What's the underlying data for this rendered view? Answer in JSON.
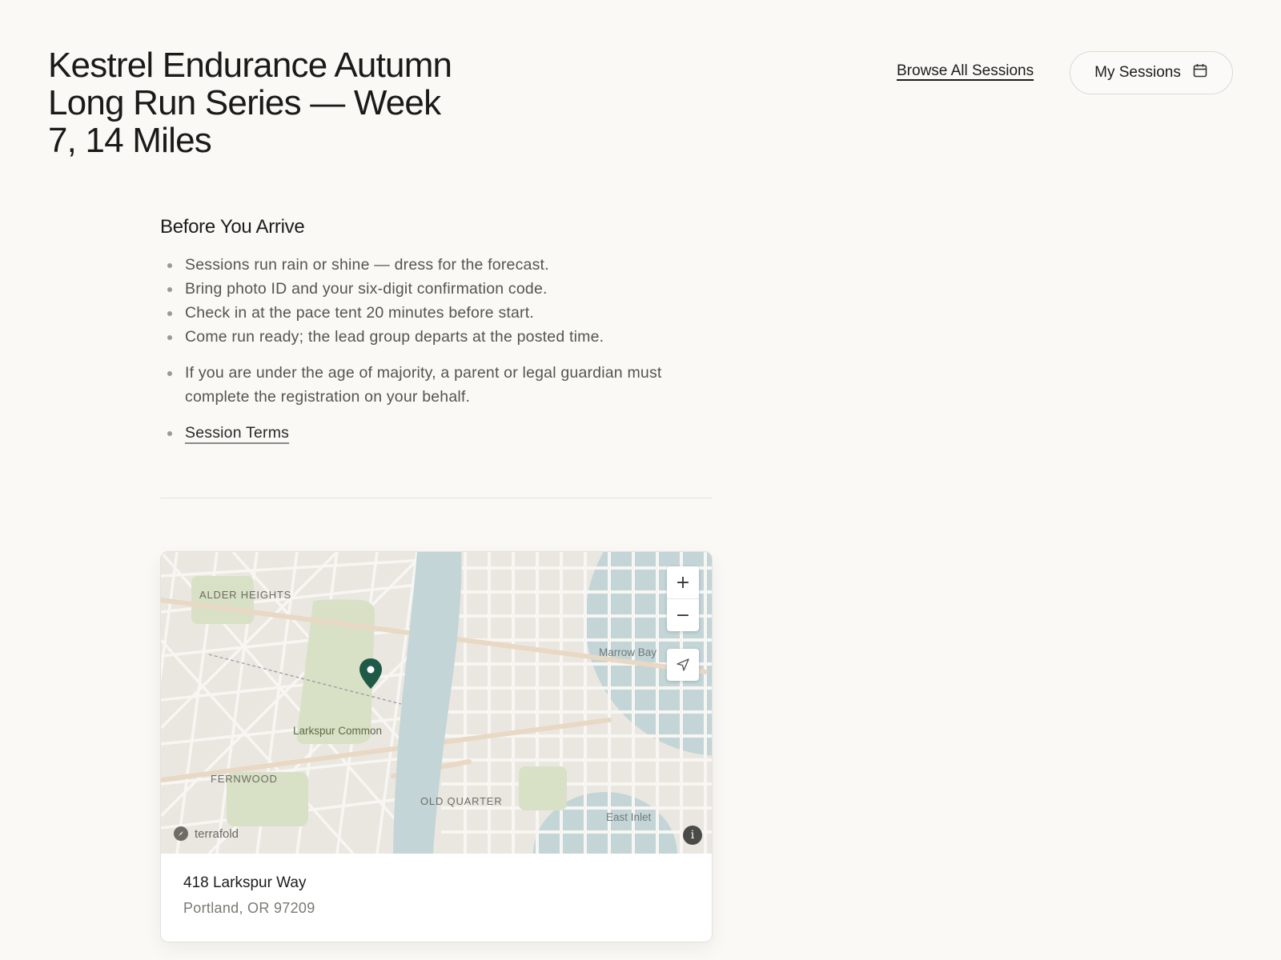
{
  "header": {
    "title": "Kestrel Endurance Autumn Long Run Series — Week 7, 14 Miles",
    "browse_link": "Browse All Sessions",
    "my_sessions_label": "My Sessions",
    "my_sessions_icon": "calendar-icon"
  },
  "before_arrive": {
    "heading": "Before You Arrive",
    "items": [
      "Sessions run rain or shine — dress for the forecast.",
      "Bring photo ID and your six-digit confirmation code.",
      "Check in at the pace tent 20 minutes before start.",
      "Come run ready; the lead group departs at the posted time.",
      "If you are under the age of majority, a parent or legal guardian must complete the registration on your behalf."
    ],
    "terms_link": "Session Terms"
  },
  "map": {
    "districts": [
      "ALDER HEIGHTS",
      "FERNWOOD",
      "OLD QUARTER"
    ],
    "water": [
      "Marrow Bay",
      "East Inlet"
    ],
    "park": "Larkspur Common",
    "attribution": "terrafold",
    "zoom_in": "+",
    "zoom_out": "−",
    "info": "i",
    "colors": {
      "land": "#eae7e1",
      "water": "#c3d5d7",
      "park": "#d8e1c6",
      "pin": "#1f5a48"
    }
  },
  "address": {
    "line1": "418 Larkspur Way",
    "line2": "Portland, OR 97209"
  }
}
